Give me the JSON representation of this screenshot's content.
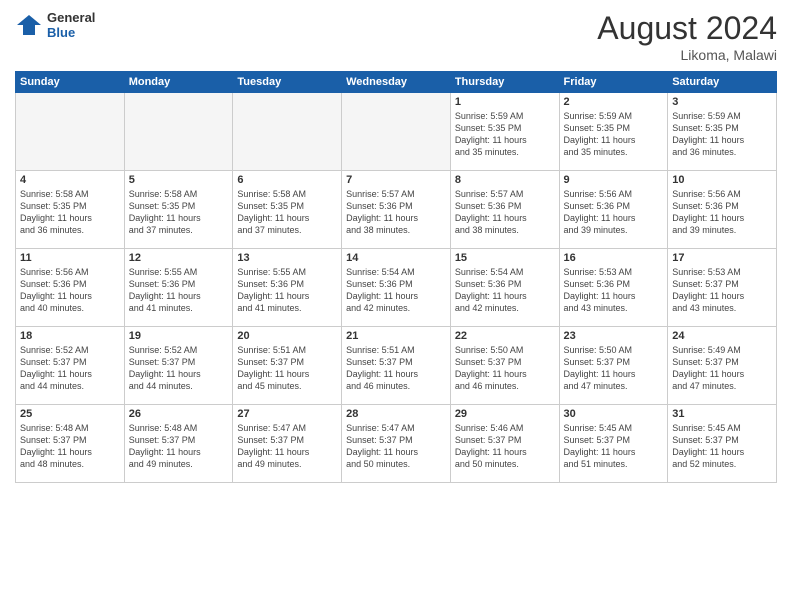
{
  "header": {
    "logo_general": "General",
    "logo_blue": "Blue",
    "month_year": "August 2024",
    "location": "Likoma, Malawi"
  },
  "days_of_week": [
    "Sunday",
    "Monday",
    "Tuesday",
    "Wednesday",
    "Thursday",
    "Friday",
    "Saturday"
  ],
  "weeks": [
    [
      {
        "day": "",
        "info": ""
      },
      {
        "day": "",
        "info": ""
      },
      {
        "day": "",
        "info": ""
      },
      {
        "day": "",
        "info": ""
      },
      {
        "day": "1",
        "info": "Sunrise: 5:59 AM\nSunset: 5:35 PM\nDaylight: 11 hours\nand 35 minutes."
      },
      {
        "day": "2",
        "info": "Sunrise: 5:59 AM\nSunset: 5:35 PM\nDaylight: 11 hours\nand 35 minutes."
      },
      {
        "day": "3",
        "info": "Sunrise: 5:59 AM\nSunset: 5:35 PM\nDaylight: 11 hours\nand 36 minutes."
      }
    ],
    [
      {
        "day": "4",
        "info": "Sunrise: 5:58 AM\nSunset: 5:35 PM\nDaylight: 11 hours\nand 36 minutes."
      },
      {
        "day": "5",
        "info": "Sunrise: 5:58 AM\nSunset: 5:35 PM\nDaylight: 11 hours\nand 37 minutes."
      },
      {
        "day": "6",
        "info": "Sunrise: 5:58 AM\nSunset: 5:35 PM\nDaylight: 11 hours\nand 37 minutes."
      },
      {
        "day": "7",
        "info": "Sunrise: 5:57 AM\nSunset: 5:36 PM\nDaylight: 11 hours\nand 38 minutes."
      },
      {
        "day": "8",
        "info": "Sunrise: 5:57 AM\nSunset: 5:36 PM\nDaylight: 11 hours\nand 38 minutes."
      },
      {
        "day": "9",
        "info": "Sunrise: 5:56 AM\nSunset: 5:36 PM\nDaylight: 11 hours\nand 39 minutes."
      },
      {
        "day": "10",
        "info": "Sunrise: 5:56 AM\nSunset: 5:36 PM\nDaylight: 11 hours\nand 39 minutes."
      }
    ],
    [
      {
        "day": "11",
        "info": "Sunrise: 5:56 AM\nSunset: 5:36 PM\nDaylight: 11 hours\nand 40 minutes."
      },
      {
        "day": "12",
        "info": "Sunrise: 5:55 AM\nSunset: 5:36 PM\nDaylight: 11 hours\nand 41 minutes."
      },
      {
        "day": "13",
        "info": "Sunrise: 5:55 AM\nSunset: 5:36 PM\nDaylight: 11 hours\nand 41 minutes."
      },
      {
        "day": "14",
        "info": "Sunrise: 5:54 AM\nSunset: 5:36 PM\nDaylight: 11 hours\nand 42 minutes."
      },
      {
        "day": "15",
        "info": "Sunrise: 5:54 AM\nSunset: 5:36 PM\nDaylight: 11 hours\nand 42 minutes."
      },
      {
        "day": "16",
        "info": "Sunrise: 5:53 AM\nSunset: 5:36 PM\nDaylight: 11 hours\nand 43 minutes."
      },
      {
        "day": "17",
        "info": "Sunrise: 5:53 AM\nSunset: 5:37 PM\nDaylight: 11 hours\nand 43 minutes."
      }
    ],
    [
      {
        "day": "18",
        "info": "Sunrise: 5:52 AM\nSunset: 5:37 PM\nDaylight: 11 hours\nand 44 minutes."
      },
      {
        "day": "19",
        "info": "Sunrise: 5:52 AM\nSunset: 5:37 PM\nDaylight: 11 hours\nand 44 minutes."
      },
      {
        "day": "20",
        "info": "Sunrise: 5:51 AM\nSunset: 5:37 PM\nDaylight: 11 hours\nand 45 minutes."
      },
      {
        "day": "21",
        "info": "Sunrise: 5:51 AM\nSunset: 5:37 PM\nDaylight: 11 hours\nand 46 minutes."
      },
      {
        "day": "22",
        "info": "Sunrise: 5:50 AM\nSunset: 5:37 PM\nDaylight: 11 hours\nand 46 minutes."
      },
      {
        "day": "23",
        "info": "Sunrise: 5:50 AM\nSunset: 5:37 PM\nDaylight: 11 hours\nand 47 minutes."
      },
      {
        "day": "24",
        "info": "Sunrise: 5:49 AM\nSunset: 5:37 PM\nDaylight: 11 hours\nand 47 minutes."
      }
    ],
    [
      {
        "day": "25",
        "info": "Sunrise: 5:48 AM\nSunset: 5:37 PM\nDaylight: 11 hours\nand 48 minutes."
      },
      {
        "day": "26",
        "info": "Sunrise: 5:48 AM\nSunset: 5:37 PM\nDaylight: 11 hours\nand 49 minutes."
      },
      {
        "day": "27",
        "info": "Sunrise: 5:47 AM\nSunset: 5:37 PM\nDaylight: 11 hours\nand 49 minutes."
      },
      {
        "day": "28",
        "info": "Sunrise: 5:47 AM\nSunset: 5:37 PM\nDaylight: 11 hours\nand 50 minutes."
      },
      {
        "day": "29",
        "info": "Sunrise: 5:46 AM\nSunset: 5:37 PM\nDaylight: 11 hours\nand 50 minutes."
      },
      {
        "day": "30",
        "info": "Sunrise: 5:45 AM\nSunset: 5:37 PM\nDaylight: 11 hours\nand 51 minutes."
      },
      {
        "day": "31",
        "info": "Sunrise: 5:45 AM\nSunset: 5:37 PM\nDaylight: 11 hours\nand 52 minutes."
      }
    ]
  ]
}
